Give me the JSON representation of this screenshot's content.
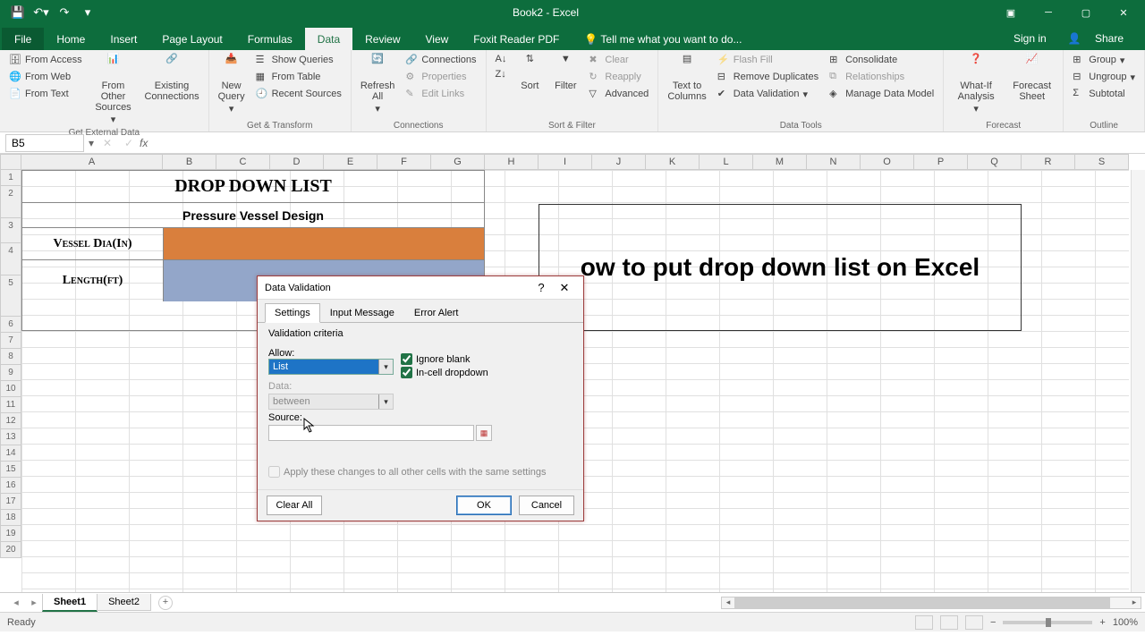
{
  "app": {
    "title": "Book2 - Excel"
  },
  "qat": {
    "save": "💾",
    "undo": "↶",
    "redo": "↷"
  },
  "window": {
    "min": "─",
    "max": "▢",
    "close": "✕",
    "ribbon_opts": "▾"
  },
  "account": {
    "signin": "Sign in",
    "share": "Share"
  },
  "tabs": {
    "file": "File",
    "home": "Home",
    "insert": "Insert",
    "page_layout": "Page Layout",
    "formulas": "Formulas",
    "data": "Data",
    "review": "Review",
    "view": "View",
    "foxit": "Foxit Reader PDF",
    "tellme": "Tell me what you want to do..."
  },
  "ribbon": {
    "get_ext": {
      "access": "From Access",
      "web": "From Web",
      "text": "From Text",
      "other": "From Other Sources",
      "existing": "Existing Connections",
      "group": "Get External Data"
    },
    "get_trans": {
      "new_query": "New Query",
      "show_queries": "Show Queries",
      "from_table": "From Table",
      "recent": "Recent Sources",
      "group": "Get & Transform"
    },
    "conn": {
      "refresh": "Refresh All",
      "connections": "Connections",
      "properties": "Properties",
      "edit_links": "Edit Links",
      "group": "Connections"
    },
    "sortfilter": {
      "az": "A↓Z",
      "za": "Z↓A",
      "sort": "Sort",
      "filter": "Filter",
      "clear": "Clear",
      "reapply": "Reapply",
      "advanced": "Advanced",
      "group": "Sort & Filter"
    },
    "datatools": {
      "ttc": "Text to Columns",
      "flash": "Flash Fill",
      "remdup": "Remove Duplicates",
      "dval": "Data Validation",
      "consol": "Consolidate",
      "rel": "Relationships",
      "mdm": "Manage Data Model",
      "group": "Data Tools"
    },
    "forecast": {
      "whatif": "What-If Analysis",
      "fsheet": "Forecast Sheet",
      "group": "Forecast"
    },
    "outline": {
      "group": "Group",
      "ungroup": "Ungroup",
      "subtotal": "Subtotal",
      "label": "Outline"
    }
  },
  "namebox": "B5",
  "columns": [
    "A",
    "B",
    "C",
    "D",
    "E",
    "F",
    "G",
    "H",
    "I",
    "J",
    "K",
    "L",
    "M",
    "N",
    "O",
    "P",
    "Q",
    "R",
    "S"
  ],
  "rows": [
    "1",
    "2",
    "3",
    "4",
    "5",
    "6",
    "7",
    "8",
    "9",
    "10",
    "11",
    "12",
    "13",
    "14",
    "15",
    "16",
    "17",
    "18",
    "19",
    "20"
  ],
  "sheet": {
    "title": "DROP DOWN LIST",
    "subtitle": "Pressure Vessel Design",
    "label4": "Vessel Dia(In)",
    "label5": "Length(ft)",
    "note": "ow to put drop down list on Excel"
  },
  "dialog": {
    "title": "Data Validation",
    "tabs": {
      "settings": "Settings",
      "input_msg": "Input Message",
      "error": "Error Alert"
    },
    "criteria_label": "Validation criteria",
    "allow_label": "Allow:",
    "allow_value": "List",
    "ignore_blank": "Ignore blank",
    "incell": "In-cell dropdown",
    "data_label": "Data:",
    "data_value": "between",
    "source_label": "Source:",
    "apply": "Apply these changes to all other cells with the same settings",
    "clear": "Clear All",
    "ok": "OK",
    "cancel": "Cancel",
    "help": "?",
    "close": "✕"
  },
  "sheets": {
    "s1": "Sheet1",
    "s2": "Sheet2",
    "add": "+"
  },
  "status": {
    "ready": "Ready",
    "zoom": "100%"
  }
}
